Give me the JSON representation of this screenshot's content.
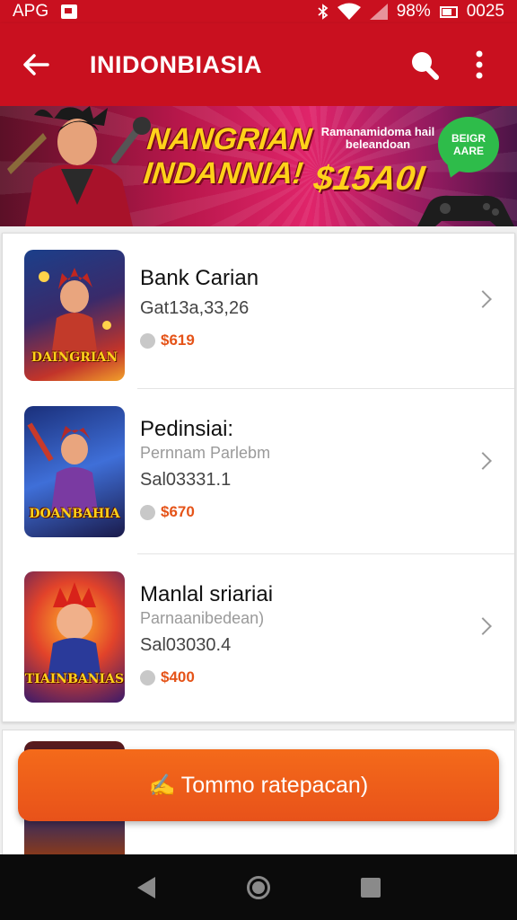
{
  "status_bar": {
    "carrier": "APG",
    "battery_percent": "98%",
    "time": "0025"
  },
  "app_bar": {
    "title": "INIDONBIASIA",
    "back_icon": "back-arrow-icon",
    "search_icon": "search-icon",
    "menu_icon": "more-vert-icon"
  },
  "banner": {
    "headline": "NANGRIAN INDANNIA!",
    "promo_subtitle": "Ramanamidoma hail beleandoan",
    "promo_amount": "$15A0I",
    "bubble_text": "BEIGR\nAARE"
  },
  "list": {
    "items": [
      {
        "title": "Bank Carian",
        "subtitle": "",
        "meta": "Gat13a,33,26",
        "price": "$619",
        "thumb_label": "DAINGRIAN",
        "colors": [
          "#1b3f8a",
          "#c2342a",
          "#f2a12a"
        ]
      },
      {
        "title": "Pedinsiai:",
        "subtitle": "Pernnam Parlebm",
        "meta": "Sal03331.1",
        "price": "$670",
        "thumb_label": "DOANBAHIA",
        "colors": [
          "#1a2f7a",
          "#3f6fd8",
          "#c73a2a"
        ]
      },
      {
        "title": "Manlal sriariai",
        "subtitle": "Parnaanibedean)",
        "meta": "Sal03030.4",
        "price": "$400",
        "thumb_label": "TIAINBANIAS",
        "colors": [
          "#3a1a6a",
          "#e2432a",
          "#ffb22a"
        ]
      }
    ]
  },
  "cta": {
    "icon": "pencil-icon",
    "label": "Tommo ratepacan)"
  },
  "theme": {
    "primary": "#c9101f",
    "accent": "#e8521a",
    "price_color": "#e55318"
  }
}
